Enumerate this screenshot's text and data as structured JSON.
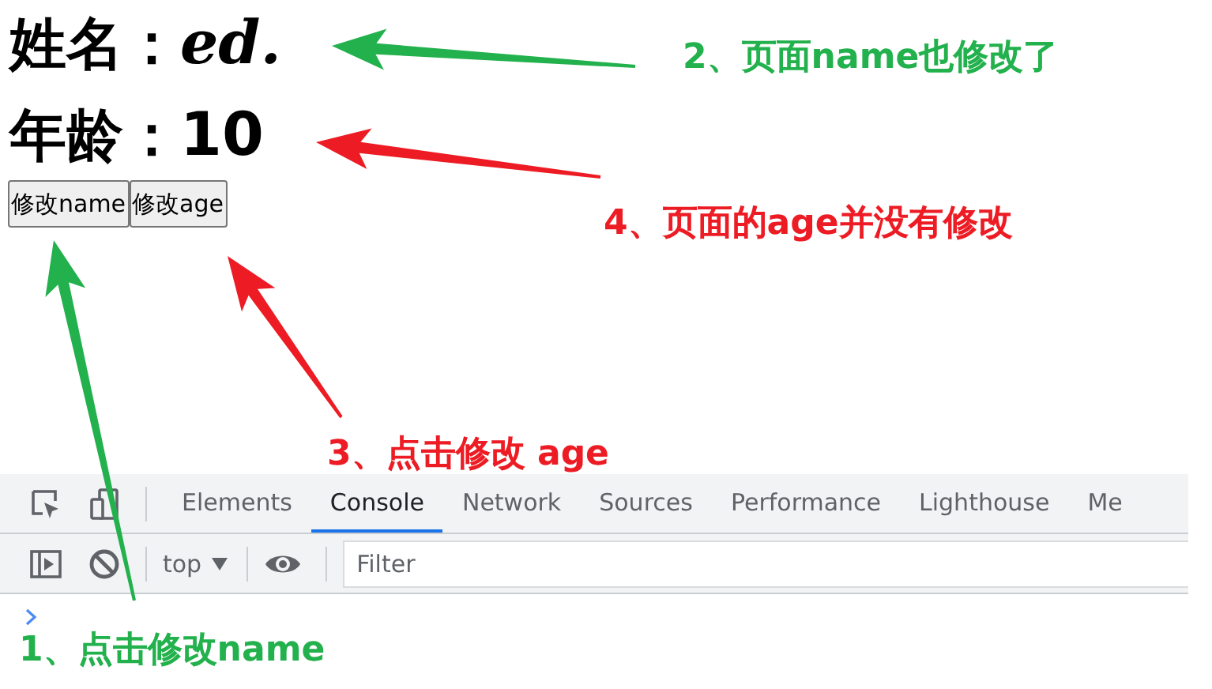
{
  "fields": [
    {
      "label": "姓名：",
      "value": "ed.",
      "italic": true
    },
    {
      "label": "年龄：",
      "value": "10",
      "italic": false
    }
  ],
  "buttons": [
    "修改name",
    "修改age"
  ],
  "devtools": {
    "tabs": [
      {
        "label": "Elements",
        "selected": false
      },
      {
        "label": "Console",
        "selected": true
      },
      {
        "label": "Network",
        "selected": false
      },
      {
        "label": "Sources",
        "selected": false
      },
      {
        "label": "Performance",
        "selected": false
      },
      {
        "label": "Lighthouse",
        "selected": false
      },
      {
        "label": "Me",
        "selected": false
      }
    ],
    "context": "top",
    "filter": {
      "placeholder": "Filter"
    }
  },
  "annotations": [
    {
      "text": "1、点击修改name",
      "color": "#22b14c"
    },
    {
      "text": "2、页面name也修改了",
      "color": "#22b14c"
    },
    {
      "text": "3、点击修改 age",
      "color": "#ed1c24"
    },
    {
      "text": "4、页面的age并没有修改",
      "color": "#ed1c24"
    }
  ]
}
